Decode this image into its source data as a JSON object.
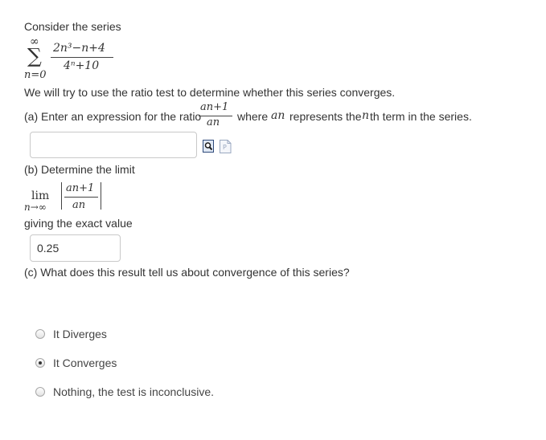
{
  "intro": "Consider the series",
  "series": {
    "sum_symbol": "∑",
    "upper_limit": "∞",
    "lower_limit": "n=0",
    "numerator": "2n³−n+4",
    "denominator": "4ⁿ+10"
  },
  "ratio_intro": "We will try to use the ratio test to determine whether this series converges.",
  "part_a": {
    "prefix": "(a) Enter an expression for the ratio",
    "ratio_num": "an+1",
    "ratio_den": "an",
    "where": "where",
    "an": "an",
    "represents": "represents the",
    "nth_n": "n",
    "suffix": "th term in the series.",
    "input_value": "",
    "preview_icon": "magnifier-preview-icon",
    "help_icon": "document-help-icon"
  },
  "part_b": {
    "label": "(b) Determine the limit",
    "lim": "lim",
    "lim_sub": "n→∞",
    "abs_num": "an+1",
    "abs_den": "an",
    "exact_label": "giving the exact value",
    "input_value": "0.25"
  },
  "part_c": {
    "question": "(c) What does this result tell us about convergence of this series?",
    "options": [
      {
        "label": "It Diverges",
        "selected": false
      },
      {
        "label": "It Converges",
        "selected": true
      },
      {
        "label": "Nothing, the test is inconclusive.",
        "selected": false
      }
    ]
  }
}
